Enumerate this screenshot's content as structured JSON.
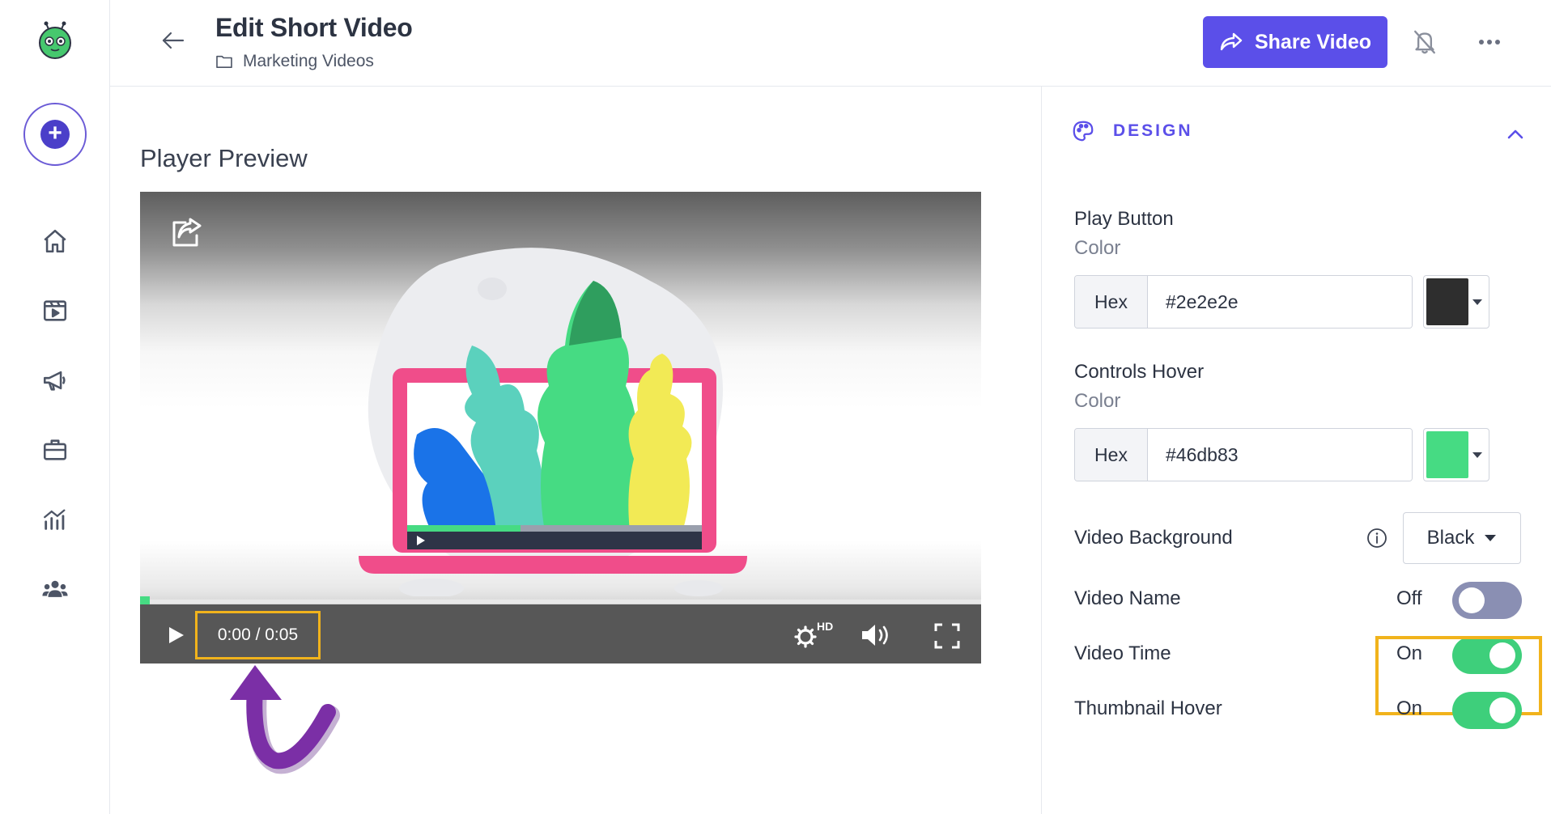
{
  "header": {
    "title": "Edit Short Video",
    "folder": "Marketing Videos",
    "share_label": "Share Video"
  },
  "main": {
    "section_title": "Player Preview",
    "player": {
      "time_display": "0:00 / 0:05",
      "hd_label": "HD",
      "progress_fraction": 0.0
    }
  },
  "panel": {
    "section_label": "DESIGN",
    "play_button": {
      "label": "Play Button",
      "sublabel": "Color",
      "prefix": "Hex",
      "value": "#2e2e2e",
      "swatch": "#2e2e2e"
    },
    "controls_hover": {
      "label": "Controls Hover",
      "sublabel": "Color",
      "prefix": "Hex",
      "value": "#46db83",
      "swatch": "#46db83"
    },
    "video_background": {
      "label": "Video Background",
      "selected": "Black"
    },
    "toggles": [
      {
        "label": "Video Name",
        "state": "Off"
      },
      {
        "label": "Video Time",
        "state": "On"
      },
      {
        "label": "Thumbnail Hover",
        "state": "On"
      }
    ]
  },
  "colors": {
    "accent": "#5b4fe9",
    "toggle_on": "#3ecf7b",
    "toggle_off": "#8a8fb3",
    "highlight": "#f1b31c",
    "annotation_arrow": "#7b2fa6"
  },
  "icons": [
    "app-logo-icon",
    "plus-icon",
    "home-icon",
    "video-library-icon",
    "megaphone-icon",
    "briefcase-icon",
    "analytics-icon",
    "team-icon",
    "arrow-left-icon",
    "folder-icon",
    "share-icon",
    "bell-off-icon",
    "more-horizontal-icon",
    "palette-icon",
    "chevron-up-icon",
    "info-icon",
    "caret-down-icon",
    "play-icon",
    "settings-icon",
    "volume-icon",
    "fullscreen-icon"
  ]
}
